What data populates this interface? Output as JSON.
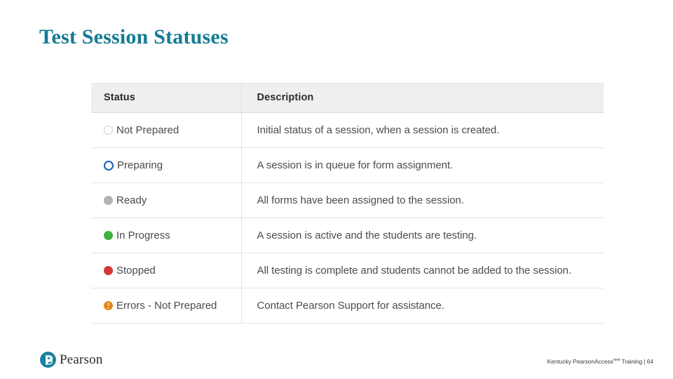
{
  "slide": {
    "title": "Test Session Statuses"
  },
  "table": {
    "columns": [
      "Status",
      "Description"
    ],
    "rows": [
      {
        "status": "Not Prepared",
        "icon": "gray-hollow-circle-icon",
        "icon_color": "#cfcfcf",
        "description": "Initial status of a session, when a session is created."
      },
      {
        "status": "Preparing",
        "icon": "blue-ring-circle-icon",
        "icon_color": "#1a5cc8",
        "description": "A session is in queue for form assignment."
      },
      {
        "status": "Ready",
        "icon": "gray-filled-circle-icon",
        "icon_color": "#b3b3b3",
        "description": "All forms have been assigned to the session."
      },
      {
        "status": "In Progress",
        "icon": "green-filled-circle-icon",
        "icon_color": "#3fb13f",
        "description": "A session is active and the students are testing."
      },
      {
        "status": "Stopped",
        "icon": "red-filled-circle-icon",
        "icon_color": "#d6383a",
        "description": "All testing is complete and students cannot be added to the session."
      },
      {
        "status": "Errors - Not Prepared",
        "icon": "orange-exclamation-circle-icon",
        "icon_color": "#e8891c",
        "description": "Contact Pearson Support for assistance."
      }
    ]
  },
  "footer": {
    "logo_word": "Pearson",
    "logo_icon": "pearson-interlocking-p-logo",
    "note_prefix": "Kentucky PearsonAccess",
    "note_superscript": "next",
    "note_suffix": " Training | 64"
  },
  "colors": {
    "title_teal": "#147c94",
    "header_bg": "#efefef",
    "border": "#e4e4e4",
    "logo_teal": "#16839e"
  }
}
